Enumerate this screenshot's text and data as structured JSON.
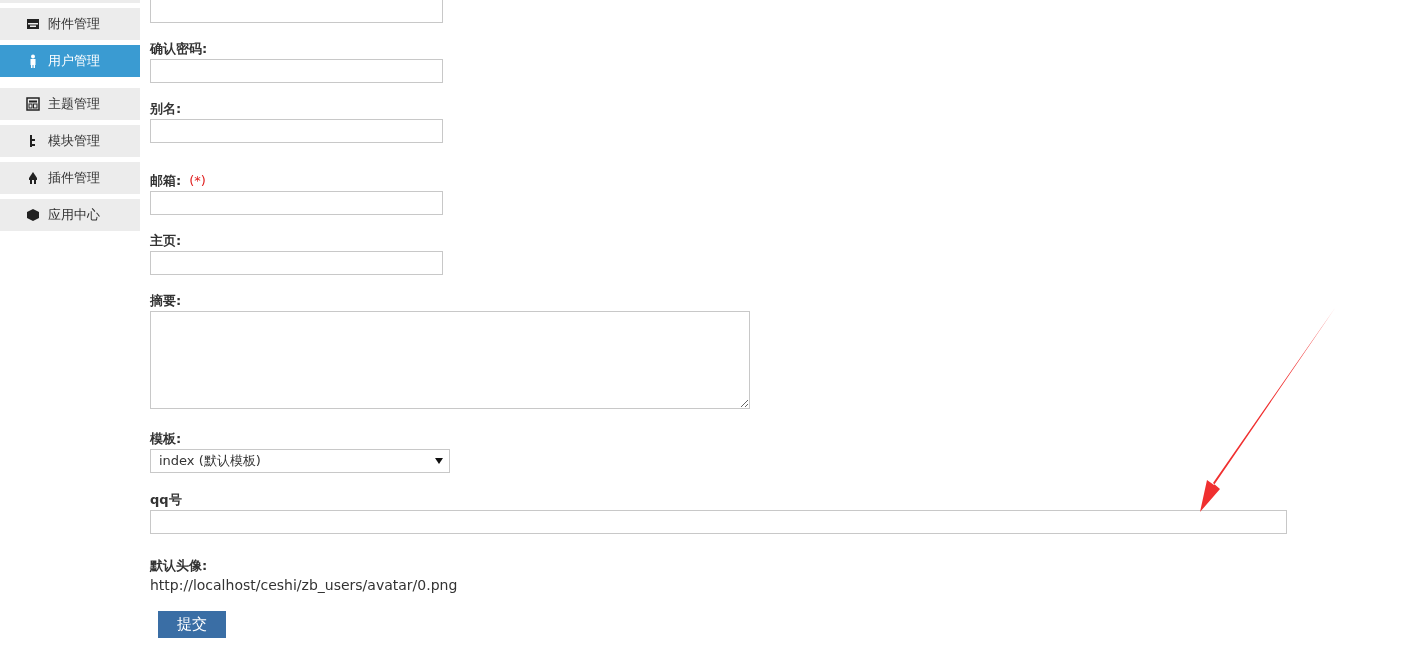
{
  "sidebar": {
    "items": [
      {
        "label": "附件管理",
        "kind": "archive",
        "selected": false
      },
      {
        "label": "用户管理",
        "kind": "user",
        "selected": true
      },
      {
        "label": "主题管理",
        "kind": "layout",
        "selected": false
      },
      {
        "label": "模块管理",
        "kind": "tree",
        "selected": false
      },
      {
        "label": "插件管理",
        "kind": "plug",
        "selected": false
      },
      {
        "label": "应用中心",
        "kind": "cube",
        "selected": false
      }
    ]
  },
  "form": {
    "fields": [
      {
        "kind": "cut"
      },
      {
        "kind": "text",
        "label": "确认密码:"
      },
      {
        "kind": "text",
        "label": "别名:"
      },
      {
        "kind": "text",
        "label": "邮箱:",
        "required_mark": "(*)"
      },
      {
        "kind": "text",
        "label": "主页:"
      },
      {
        "kind": "textarea",
        "label": "摘要:"
      },
      {
        "kind": "select",
        "label": "模板:",
        "value": "index (默认模板)"
      },
      {
        "kind": "wide",
        "label": "qq号"
      },
      {
        "kind": "info",
        "label": "默认头像:",
        "value": "http://localhost/ceshi/zb_users/avatar/0.png"
      }
    ],
    "submit": "提交"
  }
}
